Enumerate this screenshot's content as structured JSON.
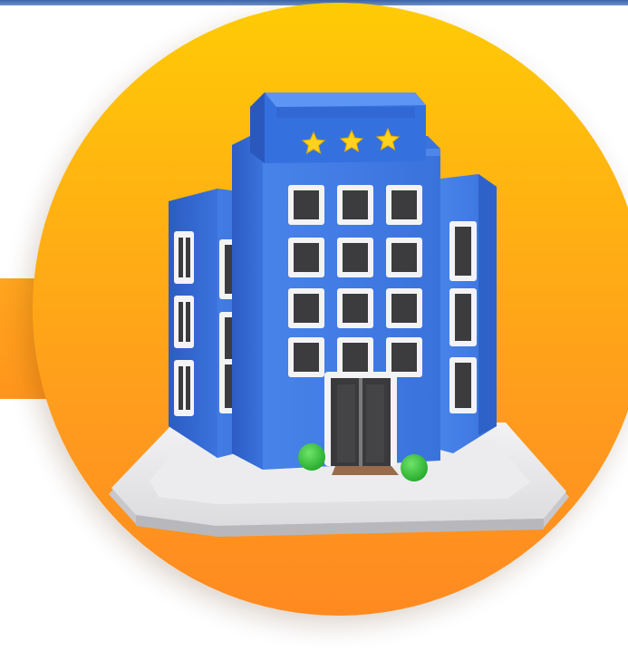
{
  "scene": {
    "subject": "hotel-building-3d-icon",
    "stars": 3,
    "colors": {
      "circle_top": "#ffcb05",
      "circle_bottom": "#ff8a20",
      "band": "#ffa51e",
      "top_bar": "#3a64a8",
      "building_blue": "#3f78e0",
      "building_dark": "#2a56b8",
      "window_frame": "#f4f4f6",
      "window_glass": "#3c3c3e",
      "star": "#ffd21c",
      "plinth": "#e4e4e6",
      "bush": "#3ccc3c",
      "doormat": "#9a6b4b"
    }
  }
}
